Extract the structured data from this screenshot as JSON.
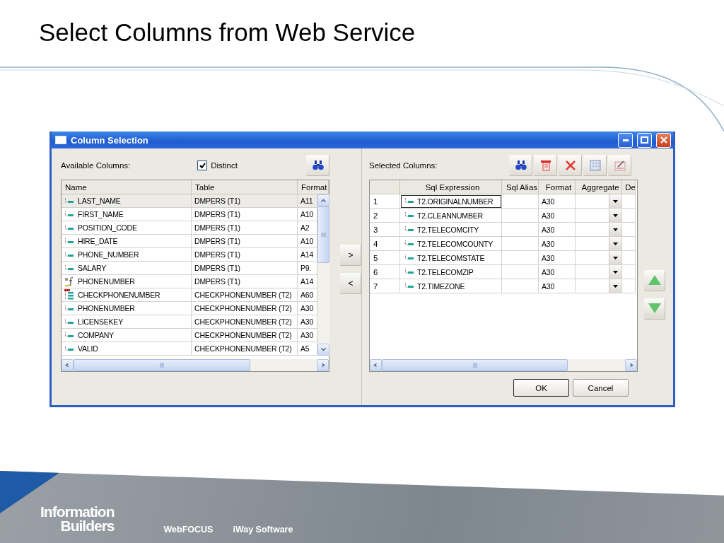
{
  "slide": {
    "title": "Select Columns from Web Service"
  },
  "dialog": {
    "title": "Column Selection",
    "available": {
      "label": "Available Columns:",
      "distinct": {
        "label": "Distinct",
        "checked": true
      },
      "columns": [
        "Name",
        "Table",
        "Format"
      ],
      "rows": [
        {
          "kind": "field",
          "name": "LAST_NAME",
          "table": "DMPERS (T1)",
          "format": "A11",
          "selected": true
        },
        {
          "kind": "field",
          "name": "FIRST_NAME",
          "table": "DMPERS (T1)",
          "format": "A10",
          "selected": false
        },
        {
          "kind": "field",
          "name": "POSITION_CODE",
          "table": "DMPERS (T1)",
          "format": "A2",
          "selected": false
        },
        {
          "kind": "field",
          "name": "HIRE_DATE",
          "table": "DMPERS (T1)",
          "format": "A10",
          "selected": false
        },
        {
          "kind": "field",
          "name": "PHONE_NUMBER",
          "table": "DMPERS (T1)",
          "format": "A14",
          "selected": false
        },
        {
          "kind": "field",
          "name": "SALARY",
          "table": "DMPERS (T1)",
          "format": "P9.",
          "selected": false
        },
        {
          "kind": "compute",
          "name": "PHONENUMBER",
          "table": "DMPERS (T1)",
          "format": "A14",
          "selected": false
        },
        {
          "kind": "segment",
          "name": "CHECKPHONENUMBER",
          "table": "CHECKPHONENUMBER (T2)",
          "format": "A60",
          "selected": false
        },
        {
          "kind": "field",
          "name": "PHONENUMBER",
          "table": "CHECKPHONENUMBER (T2)",
          "format": "A30",
          "selected": false
        },
        {
          "kind": "field",
          "name": "LICENSEKEY",
          "table": "CHECKPHONENUMBER (T2)",
          "format": "A30",
          "selected": false
        },
        {
          "kind": "field",
          "name": "COMPANY",
          "table": "CHECKPHONENUMBER (T2)",
          "format": "A30",
          "selected": false
        },
        {
          "kind": "field",
          "name": "VALID",
          "table": "CHECKPHONENUMBER (T2)",
          "format": "A5",
          "selected": false
        }
      ]
    },
    "move_buttons": [
      ">",
      "<"
    ],
    "selected": {
      "label": "Selected Columns:",
      "columns": [
        "Sql Expression",
        "Sql Alias",
        "Format",
        "Aggregate",
        "De"
      ],
      "rows": [
        {
          "number": "1",
          "expression": "T2.ORIGINALNUMBER",
          "format": "A30",
          "selected": true
        },
        {
          "number": "2",
          "expression": "T2.CLEANNUMBER",
          "format": "A30",
          "selected": false
        },
        {
          "number": "3",
          "expression": "T2.TELECOMCITY",
          "format": "A30",
          "selected": false
        },
        {
          "number": "4",
          "expression": "T2.TELECOMCOUNTY",
          "format": "A30",
          "selected": false
        },
        {
          "number": "5",
          "expression": "T2.TELECOMSTATE",
          "format": "A30",
          "selected": false
        },
        {
          "number": "6",
          "expression": "T2.TELECOMZIP",
          "format": "A30",
          "selected": false
        },
        {
          "number": "7",
          "expression": "T2.TIMEZONE",
          "format": "A30",
          "selected": false
        }
      ]
    },
    "buttons": [
      {
        "label": "OK",
        "default": true
      },
      {
        "label": "Cancel",
        "default": false
      }
    ]
  },
  "footer": {
    "logo": [
      "Information",
      "Builders"
    ],
    "links": [
      "WebFOCUS",
      "iWay Software"
    ]
  }
}
